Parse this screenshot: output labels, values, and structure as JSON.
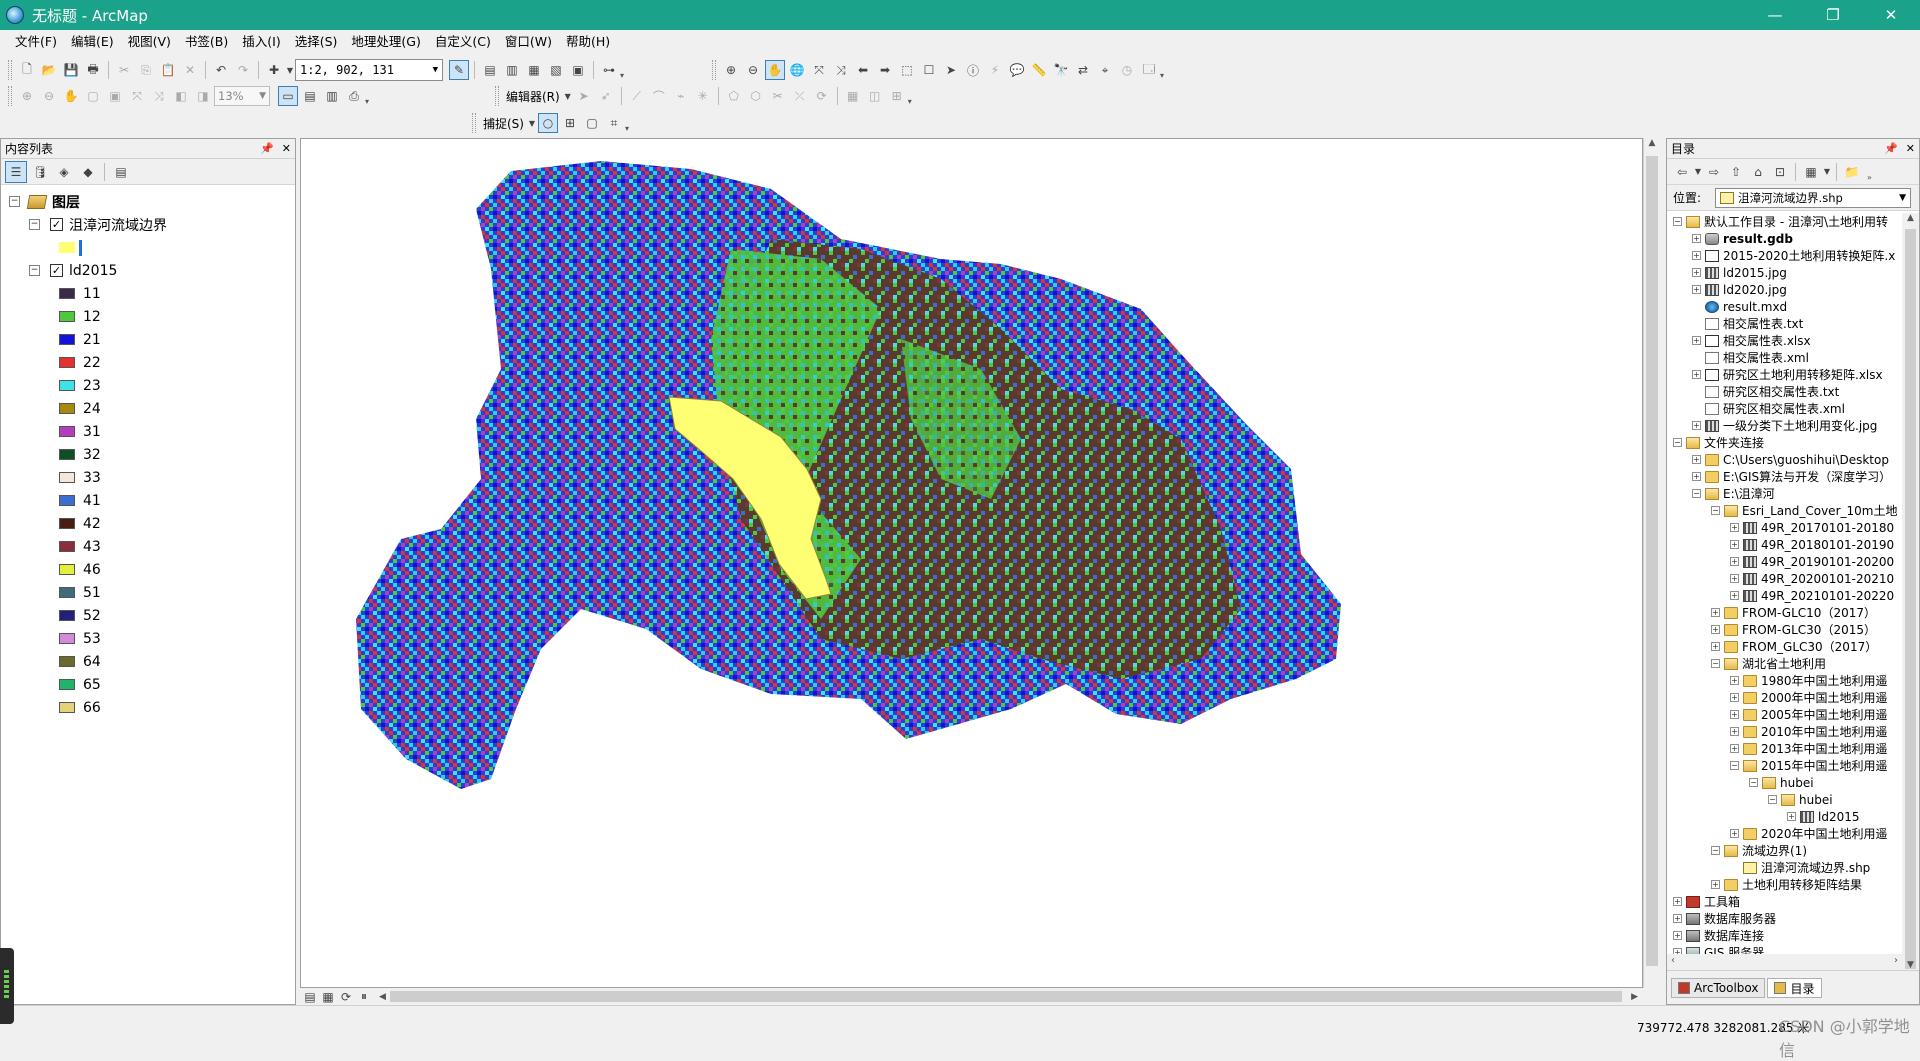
{
  "window": {
    "title": "无标题 - ArcMap",
    "min": "—",
    "restore": "❐",
    "close": "✕"
  },
  "menu": [
    "文件(F)",
    "编辑(E)",
    "视图(V)",
    "书签(B)",
    "插入(I)",
    "选择(S)",
    "地理处理(G)",
    "自定义(C)",
    "窗口(W)",
    "帮助(H)"
  ],
  "toolbar": {
    "scale": "1:2, 902, 131",
    "zoom": "13%",
    "editor_label": "编辑器(R)",
    "snapping_label": "捕捉(S)"
  },
  "toc": {
    "header": "内容列表",
    "root_label": "图层",
    "layers": [
      {
        "name": "沮漳河流域边界",
        "checked": true,
        "symbol_color": "#ffff73"
      },
      {
        "name": "ld2015",
        "checked": true
      }
    ],
    "classes": [
      {
        "value": "11",
        "color": "#3b2a4a"
      },
      {
        "value": "12",
        "color": "#4fc83d"
      },
      {
        "value": "21",
        "color": "#1212d8"
      },
      {
        "value": "22",
        "color": "#e53030"
      },
      {
        "value": "23",
        "color": "#3ee2ea"
      },
      {
        "value": "24",
        "color": "#a68a10"
      },
      {
        "value": "31",
        "color": "#b33fc0"
      },
      {
        "value": "32",
        "color": "#0f4f26"
      },
      {
        "value": "33",
        "color": "#f4e6d8"
      },
      {
        "value": "41",
        "color": "#3a6fd0"
      },
      {
        "value": "42",
        "color": "#4a1d12"
      },
      {
        "value": "43",
        "color": "#8a2d3c"
      },
      {
        "value": "46",
        "color": "#e3f03a"
      },
      {
        "value": "51",
        "color": "#3f6b7a"
      },
      {
        "value": "52",
        "color": "#24207a"
      },
      {
        "value": "53",
        "color": "#d48ad8"
      },
      {
        "value": "64",
        "color": "#6b6b2f"
      },
      {
        "value": "65",
        "color": "#1fb36b"
      },
      {
        "value": "66",
        "color": "#e6d27a"
      }
    ]
  },
  "catalog": {
    "header": "目录",
    "location_label": "位置:",
    "location_value": "沮漳河流域边界.shp",
    "tree": [
      {
        "label": "默认工作目录 - 沮漳河\\土地利用转",
        "depth": 0,
        "exp": "⊟",
        "icon": "folder-open"
      },
      {
        "label": "result.gdb",
        "depth": 1,
        "exp": "⊞",
        "icon": "gdb",
        "bold": true
      },
      {
        "label": "2015-2020土地利用转换矩阵.x",
        "depth": 1,
        "exp": "⊞",
        "icon": "xls"
      },
      {
        "label": "ld2015.jpg",
        "depth": 1,
        "exp": "⊞",
        "icon": "raster"
      },
      {
        "label": "ld2020.jpg",
        "depth": 1,
        "exp": "⊞",
        "icon": "raster"
      },
      {
        "label": "result.mxd",
        "depth": 1,
        "exp": "",
        "icon": "mxd"
      },
      {
        "label": "相交属性表.txt",
        "depth": 1,
        "exp": "",
        "icon": "doc"
      },
      {
        "label": "相交属性表.xlsx",
        "depth": 1,
        "exp": "⊞",
        "icon": "xls"
      },
      {
        "label": "相交属性表.xml",
        "depth": 1,
        "exp": "",
        "icon": "doc"
      },
      {
        "label": "研究区土地利用转移矩阵.xlsx",
        "depth": 1,
        "exp": "⊞",
        "icon": "xls"
      },
      {
        "label": "研究区相交属性表.txt",
        "depth": 1,
        "exp": "",
        "icon": "doc"
      },
      {
        "label": "研究区相交属性表.xml",
        "depth": 1,
        "exp": "",
        "icon": "doc"
      },
      {
        "label": "一级分类下土地利用变化.jpg",
        "depth": 1,
        "exp": "⊞",
        "icon": "raster"
      },
      {
        "label": "文件夹连接",
        "depth": 0,
        "exp": "⊟",
        "icon": "folder-open"
      },
      {
        "label": "C:\\Users\\guoshihui\\Desktop",
        "depth": 1,
        "exp": "⊞",
        "icon": "folder"
      },
      {
        "label": "E:\\GIS算法与开发（深度学习）",
        "depth": 1,
        "exp": "⊞",
        "icon": "folder"
      },
      {
        "label": "E:\\沮漳河",
        "depth": 1,
        "exp": "⊟",
        "icon": "folder-open"
      },
      {
        "label": "Esri_Land_Cover_10m土地",
        "depth": 2,
        "exp": "⊟",
        "icon": "folder-open"
      },
      {
        "label": "49R_20170101-20180",
        "depth": 3,
        "exp": "⊞",
        "icon": "raster"
      },
      {
        "label": "49R_20180101-20190",
        "depth": 3,
        "exp": "⊞",
        "icon": "raster"
      },
      {
        "label": "49R_20190101-20200",
        "depth": 3,
        "exp": "⊞",
        "icon": "raster"
      },
      {
        "label": "49R_20200101-20210",
        "depth": 3,
        "exp": "⊞",
        "icon": "raster"
      },
      {
        "label": "49R_20210101-20220",
        "depth": 3,
        "exp": "⊞",
        "icon": "raster"
      },
      {
        "label": "FROM-GLC10（2017）",
        "depth": 2,
        "exp": "⊞",
        "icon": "folder"
      },
      {
        "label": "FROM-GLC30（2015）",
        "depth": 2,
        "exp": "⊞",
        "icon": "folder"
      },
      {
        "label": "FROM_GLC30（2017）",
        "depth": 2,
        "exp": "⊞",
        "icon": "folder"
      },
      {
        "label": "湖北省土地利用",
        "depth": 2,
        "exp": "⊟",
        "icon": "folder-open"
      },
      {
        "label": "1980年中国土地利用遥",
        "depth": 3,
        "exp": "⊞",
        "icon": "folder"
      },
      {
        "label": "2000年中国土地利用遥",
        "depth": 3,
        "exp": "⊞",
        "icon": "folder"
      },
      {
        "label": "2005年中国土地利用遥",
        "depth": 3,
        "exp": "⊞",
        "icon": "folder"
      },
      {
        "label": "2010年中国土地利用遥",
        "depth": 3,
        "exp": "⊞",
        "icon": "folder"
      },
      {
        "label": "2013年中国土地利用遥",
        "depth": 3,
        "exp": "⊞",
        "icon": "folder"
      },
      {
        "label": "2015年中国土地利用遥",
        "depth": 3,
        "exp": "⊟",
        "icon": "folder-open"
      },
      {
        "label": "hubei",
        "depth": 4,
        "exp": "⊟",
        "icon": "folder-open"
      },
      {
        "label": "hubei",
        "depth": 5,
        "exp": "⊟",
        "icon": "folder-open"
      },
      {
        "label": "ld2015",
        "depth": 6,
        "exp": "⊞",
        "icon": "raster"
      },
      {
        "label": "2020年中国土地利用遥",
        "depth": 3,
        "exp": "⊞",
        "icon": "folder"
      },
      {
        "label": "流域边界(1)",
        "depth": 2,
        "exp": "⊟",
        "icon": "folder-open"
      },
      {
        "label": "沮漳河流域边界.shp",
        "depth": 3,
        "exp": "",
        "icon": "shp"
      },
      {
        "label": "土地利用转移矩阵结果",
        "depth": 2,
        "exp": "⊞",
        "icon": "folder"
      },
      {
        "label": "工具箱",
        "depth": 0,
        "exp": "⊞",
        "icon": "tool"
      },
      {
        "label": "数据库服务器",
        "depth": 0,
        "exp": "⊞",
        "icon": "server"
      },
      {
        "label": "数据库连接",
        "depth": 0,
        "exp": "⊞",
        "icon": "server"
      },
      {
        "label": "GIS 服务器",
        "depth": 0,
        "exp": "⊞",
        "icon": "gis"
      }
    ],
    "tabs": [
      {
        "label": "ArcToolbox",
        "active": false
      },
      {
        "label": "目录",
        "active": true
      }
    ]
  },
  "status": {
    "coords": "739772.478  3282081.285 米",
    "watermark": "CSDN @小郭学地信"
  }
}
